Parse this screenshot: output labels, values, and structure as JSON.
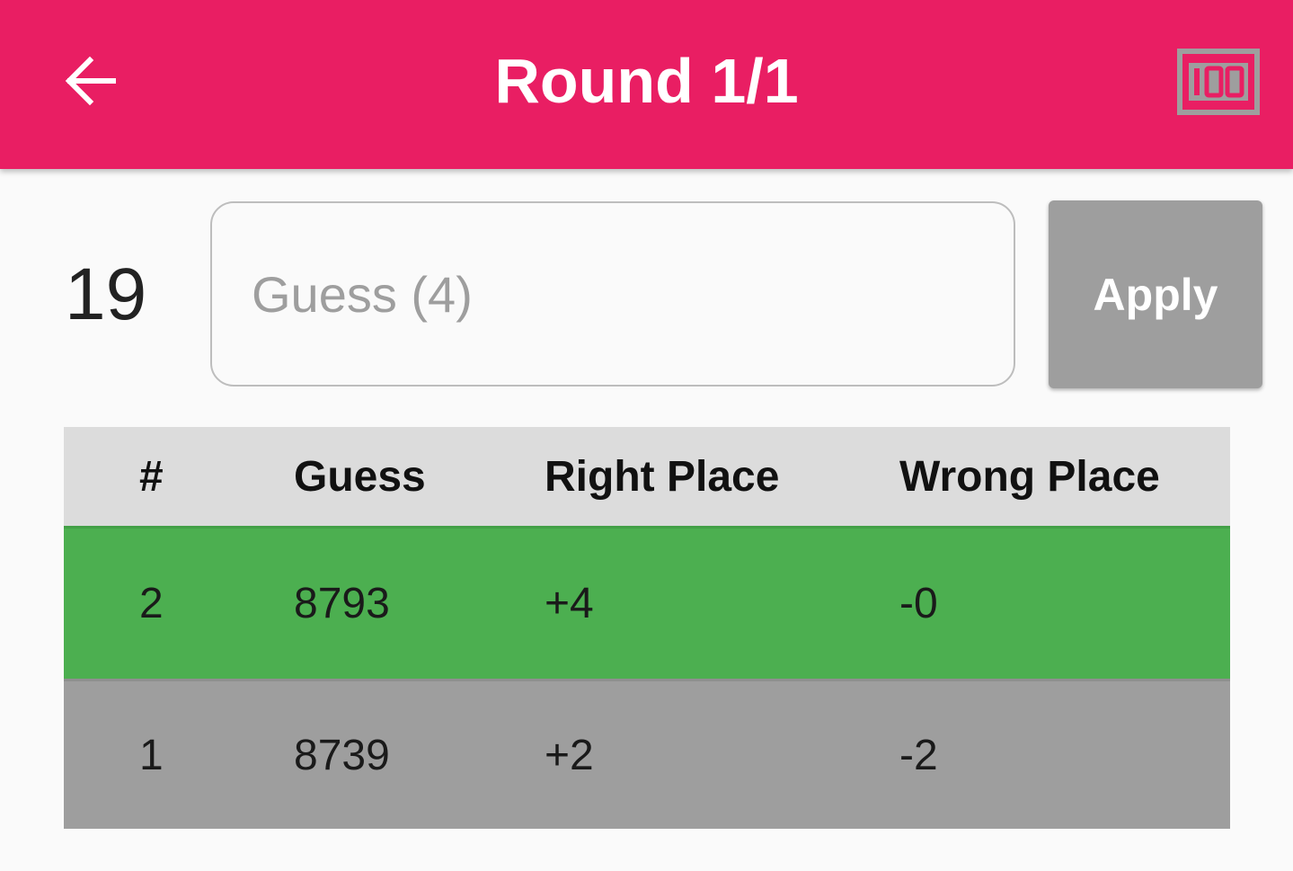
{
  "app_bar": {
    "title": "Round 1/1",
    "back_icon": "arrow-back-icon",
    "score_icon": "counter-100-icon",
    "background_color": "#e91e63"
  },
  "controls": {
    "counter_value": "19",
    "guess_placeholder": "Guess (4)",
    "guess_value": "",
    "apply_label": "Apply",
    "apply_color": "#9e9e9e"
  },
  "table": {
    "columns": [
      "#",
      "Guess",
      "Right Place",
      "Wrong Place"
    ],
    "rows": [
      {
        "num": "2",
        "guess": "8793",
        "right": "+4",
        "wrong": "-0",
        "color": "#4caf50"
      },
      {
        "num": "1",
        "guess": "8739",
        "right": "+2",
        "wrong": "-2",
        "color": "#9e9e9e"
      }
    ]
  }
}
